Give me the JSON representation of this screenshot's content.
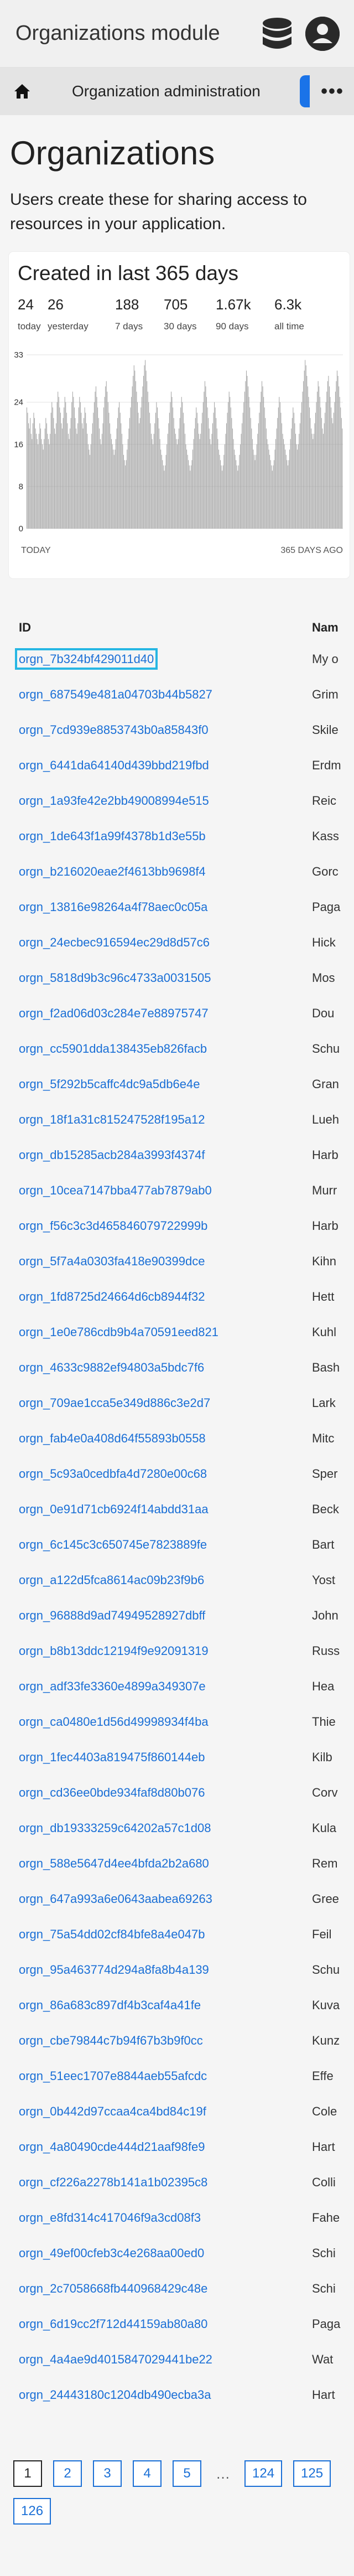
{
  "header": {
    "app_title": "Organizations module",
    "icons": [
      "database-icon",
      "user-icon"
    ]
  },
  "nav": {
    "home_icon": "home-icon",
    "label": "Organization administration",
    "more_icon": "more-icon",
    "accent_color": "#1a73e8"
  },
  "page": {
    "title": "Organizations",
    "description": "Users create these for sharing access to resources in your application."
  },
  "stats_card": {
    "title": "Created in last 365 days",
    "stats": [
      {
        "value": "24",
        "label": "today"
      },
      {
        "value": "26",
        "label": "yesterday"
      },
      {
        "value": "188",
        "label": "7 days"
      },
      {
        "value": "705",
        "label": "30 days"
      },
      {
        "value": "1.67k",
        "label": "90 days"
      },
      {
        "value": "6.3k",
        "label": "all time"
      }
    ],
    "x_left_label": "TODAY",
    "x_right_label": "365 DAYS AGO"
  },
  "chart_data": {
    "type": "bar",
    "title": "Created in last 365 days",
    "xlabel": "",
    "ylabel": "",
    "x_tick_labels": [
      "TODAY",
      "365 DAYS AGO"
    ],
    "y_ticks": [
      0,
      8,
      16,
      24,
      33
    ],
    "ylim": [
      0,
      33
    ],
    "grid": true,
    "values": [
      23,
      22,
      20,
      19,
      21,
      18,
      17,
      20,
      22,
      21,
      19,
      18,
      17,
      16,
      18,
      20,
      19,
      17,
      16,
      15,
      17,
      19,
      21,
      20,
      18,
      17,
      16,
      18,
      22,
      24,
      23,
      21,
      19,
      18,
      20,
      24,
      26,
      25,
      23,
      22,
      20,
      19,
      21,
      23,
      25,
      24,
      22,
      20,
      18,
      17,
      19,
      21,
      24,
      26,
      25,
      23,
      21,
      19,
      18,
      20,
      23,
      25,
      24,
      22,
      20,
      19,
      21,
      23,
      22,
      20,
      18,
      16,
      15,
      14,
      16,
      18,
      20,
      22,
      24,
      26,
      27,
      25,
      23,
      21,
      19,
      17,
      16,
      18,
      20,
      23,
      25,
      27,
      28,
      26,
      24,
      22,
      20,
      18,
      17,
      16,
      15,
      14,
      15,
      17,
      19,
      21,
      23,
      24,
      22,
      20,
      18,
      16,
      14,
      13,
      12,
      13,
      15,
      17,
      19,
      21,
      23,
      25,
      27,
      29,
      31,
      30,
      28,
      26,
      24,
      22,
      20,
      21,
      23,
      25,
      27,
      29,
      31,
      32,
      30,
      28,
      26,
      24,
      22,
      20,
      18,
      17,
      16,
      18,
      20,
      22,
      24,
      23,
      21,
      19,
      17,
      15,
      14,
      13,
      12,
      11,
      12,
      14,
      16,
      18,
      20,
      22,
      24,
      26,
      25,
      23,
      21,
      19,
      18,
      17,
      16,
      17,
      19,
      21,
      23,
      25,
      24,
      22,
      20,
      18,
      16,
      15,
      14,
      13,
      12,
      11,
      12,
      13,
      15,
      17,
      19,
      21,
      23,
      22,
      20,
      18,
      17,
      18,
      20,
      22,
      24,
      26,
      28,
      27,
      25,
      23,
      21,
      19,
      17,
      16,
      18,
      20,
      22,
      24,
      23,
      21,
      19,
      17,
      15,
      14,
      13,
      12,
      11,
      12,
      14,
      16,
      18,
      20,
      22,
      24,
      26,
      25,
      23,
      21,
      19,
      17,
      15,
      14,
      13,
      12,
      11,
      12,
      14,
      16,
      18,
      20,
      22,
      24,
      26,
      28,
      30,
      29,
      27,
      25,
      23,
      21,
      19,
      17,
      15,
      14,
      13,
      14,
      16,
      18,
      20,
      22,
      24,
      26,
      28,
      27,
      25,
      23,
      21,
      19,
      17,
      16,
      15,
      14,
      13,
      12,
      11,
      12,
      13,
      15,
      17,
      19,
      21,
      23,
      25,
      24,
      22,
      20,
      18,
      17,
      16,
      15,
      14,
      13,
      12,
      13,
      15,
      17,
      19,
      21,
      23,
      22,
      20,
      18,
      16,
      15,
      16,
      18,
      20,
      22,
      24,
      26,
      28,
      30,
      32,
      31,
      29,
      27,
      25,
      23,
      21,
      19,
      18,
      17,
      18,
      20,
      22,
      24,
      26,
      28,
      27,
      25,
      23,
      21,
      19,
      18,
      20,
      22,
      24,
      26,
      28,
      29,
      27,
      25,
      23,
      21,
      20,
      22,
      24,
      26,
      28,
      30,
      29,
      27,
      25,
      23,
      21,
      19
    ]
  },
  "table": {
    "headers": {
      "id": "ID",
      "name": "Nam"
    },
    "rows": [
      {
        "id": "orgn_7b324bf429011d40",
        "name": "My o",
        "selected": true
      },
      {
        "id": "orgn_687549e481a04703b44b5827",
        "name": "Grim"
      },
      {
        "id": "orgn_7cd939e8853743b0a85843f0",
        "name": "Skile"
      },
      {
        "id": "orgn_6441da64140d439bbd219fbd",
        "name": "Erdm"
      },
      {
        "id": "orgn_1a93fe42e2bb49008994e515",
        "name": "Reic"
      },
      {
        "id": "orgn_1de643f1a99f4378b1d3e55b",
        "name": "Kass"
      },
      {
        "id": "orgn_b216020eae2f4613bb9698f4",
        "name": "Gorc"
      },
      {
        "id": "orgn_13816e98264a4f78aec0c05a",
        "name": "Paga"
      },
      {
        "id": "orgn_24ecbec916594ec29d8d57c6",
        "name": "Hick"
      },
      {
        "id": "orgn_5818d9b3c96c4733a0031505",
        "name": "Mos"
      },
      {
        "id": "orgn_f2ad06d03c284e7e88975747",
        "name": "Dou"
      },
      {
        "id": "orgn_cc5901dda138435eb826facb",
        "name": "Schu"
      },
      {
        "id": "orgn_5f292b5caffc4dc9a5db6e4e",
        "name": "Gran"
      },
      {
        "id": "orgn_18f1a31c815247528f195a12",
        "name": "Lueh"
      },
      {
        "id": "orgn_db15285acb284a3993f4374f",
        "name": "Harb"
      },
      {
        "id": "orgn_10cea7147bba477ab7879ab0",
        "name": "Murr"
      },
      {
        "id": "orgn_f56c3c3d465846079722999b",
        "name": "Harb"
      },
      {
        "id": "orgn_5f7a4a0303fa418e90399dce",
        "name": "Kihn"
      },
      {
        "id": "orgn_1fd8725d24664d6cb8944f32",
        "name": "Hett"
      },
      {
        "id": "orgn_1e0e786cdb9b4a70591eed821",
        "name": "Kuhl"
      },
      {
        "id": "orgn_4633c9882ef94803a5bdc7f6",
        "name": "Bash"
      },
      {
        "id": "orgn_709ae1cca5e349d886c3e2d7",
        "name": "Lark"
      },
      {
        "id": "orgn_fab4e0a408d64f55893b0558",
        "name": "Mitc"
      },
      {
        "id": "orgn_5c93a0cedbfa4d7280e00c68",
        "name": "Sper"
      },
      {
        "id": "orgn_0e91d71cb6924f14abdd31aa",
        "name": "Beck"
      },
      {
        "id": "orgn_6c145c3c650745e7823889fe",
        "name": "Bart"
      },
      {
        "id": "orgn_a122d5fca8614ac09b23f9b6",
        "name": "Yost"
      },
      {
        "id": "orgn_96888d9ad74949528927dbff",
        "name": "John"
      },
      {
        "id": "orgn_b8b13ddc12194f9e92091319",
        "name": "Russ"
      },
      {
        "id": "orgn_adf33fe3360e4899a349307e",
        "name": "Hea"
      },
      {
        "id": "orgn_ca0480e1d56d49998934f4ba",
        "name": "Thie"
      },
      {
        "id": "orgn_1fec4403a819475f860144eb",
        "name": "Kilb"
      },
      {
        "id": "orgn_cd36ee0bde934faf8d80b076",
        "name": "Corv"
      },
      {
        "id": "orgn_db19333259c64202a57c1d08",
        "name": "Kula"
      },
      {
        "id": "orgn_588e5647d4ee4bfda2b2a680",
        "name": "Rem"
      },
      {
        "id": "orgn_647a993a6e0643aabea69263",
        "name": "Gree"
      },
      {
        "id": "orgn_75a54dd02cf84bfe8a4e047b",
        "name": "Feil"
      },
      {
        "id": "orgn_95a463774d294a8fa8b4a139",
        "name": "Schu"
      },
      {
        "id": "orgn_86a683c897df4b3caf4a41fe",
        "name": "Kuva"
      },
      {
        "id": "orgn_cbe79844c7b94f67b3b9f0cc",
        "name": "Kunz"
      },
      {
        "id": "orgn_51eec1707e8844aeb55afcdc",
        "name": "Effe"
      },
      {
        "id": "orgn_0b442d97ccaa4ca4bd84c19f",
        "name": "Cole"
      },
      {
        "id": "orgn_4a80490cde444d21aaf98fe9",
        "name": "Hart"
      },
      {
        "id": "orgn_cf226a2278b141a1b02395c8",
        "name": "Colli"
      },
      {
        "id": "orgn_e8fd314c417046f9a3cd08f3",
        "name": "Fahe"
      },
      {
        "id": "orgn_49ef00cfeb3c4e268aa00ed0",
        "name": "Schi"
      },
      {
        "id": "orgn_2c7058668fb440968429c48e",
        "name": "Schi"
      },
      {
        "id": "orgn_6d19cc2f712d44159ab80a80",
        "name": "Paga"
      },
      {
        "id": "orgn_4a4ae9d4015847029441be22",
        "name": "Wat"
      },
      {
        "id": "orgn_24443180c1204db490ecba3a",
        "name": "Hart"
      }
    ]
  },
  "pagination": {
    "pages": [
      "1",
      "2",
      "3",
      "4",
      "5"
    ],
    "current": "1",
    "ellipsis": "…",
    "tail_pages": [
      "124",
      "125",
      "126"
    ]
  }
}
